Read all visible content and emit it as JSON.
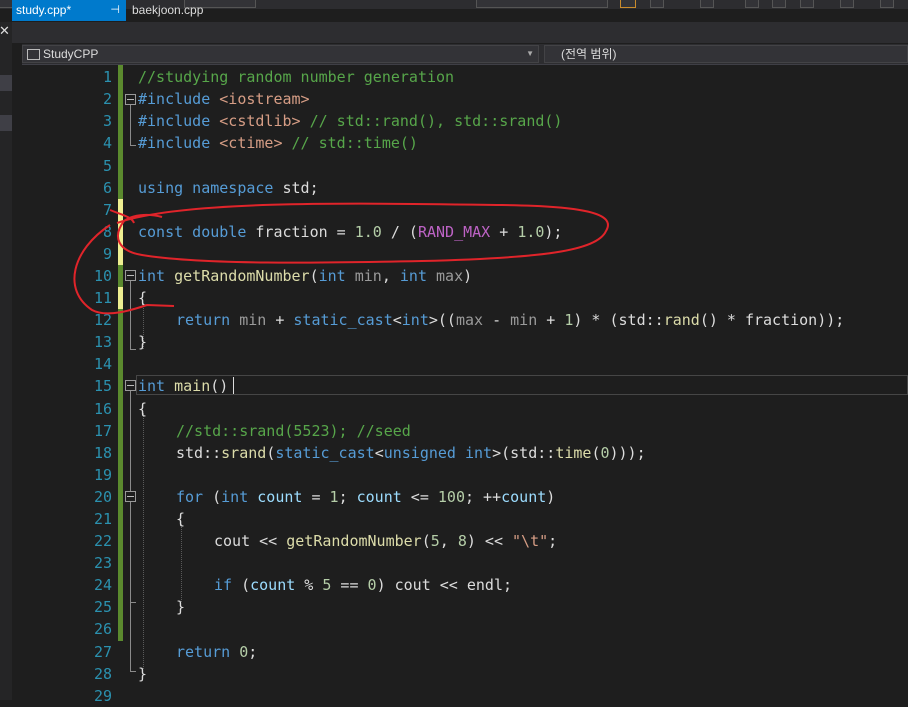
{
  "toolbar": {
    "visible": "partially cut off at top"
  },
  "tabs": [
    {
      "label": "study.cpp*",
      "pin": "⊣",
      "active": true
    },
    {
      "label": "baekjoon.cpp",
      "active": false
    }
  ],
  "left_panel": {
    "close_glyph": "✕",
    "dropdown_glyph": "▾"
  },
  "nav": {
    "project": "StudyCPP",
    "scope": "(전역 범위)"
  },
  "editor": {
    "line_numbers": [
      "1",
      "2",
      "3",
      "4",
      "5",
      "6",
      "7",
      "8",
      "9",
      "10",
      "11",
      "12",
      "13",
      "14",
      "15",
      "16",
      "17",
      "18",
      "19",
      "20",
      "21",
      "22",
      "23",
      "24",
      "25",
      "26",
      "27",
      "28",
      "29"
    ],
    "lines": {
      "l1": "//studying random number generation",
      "l2_kw": "#include ",
      "l2_hdr": "<iostream>",
      "l3_kw": "#include ",
      "l3_hdr": "<cstdlib>",
      "l3_cm": " // std::rand(), std::srand()",
      "l4_kw": "#include ",
      "l4_hdr": "<ctime>",
      "l4_cm": " // std::time()",
      "l6_a": "using namespace",
      "l6_b": " std;",
      "l8_a": "const double",
      "l8_b": " fraction = ",
      "l8_c": "1.0",
      "l8_d": " / (",
      "l8_e": "RAND_MAX",
      "l8_f": " + ",
      "l8_g": "1.0",
      "l8_h": ");",
      "l10_a": "int",
      "l10_b": " getRandomNumber",
      "l10_c": "(",
      "l10_d": "int",
      "l10_e": " min",
      "l10_f": ", ",
      "l10_g": "int",
      "l10_h": " max",
      "l10_i": ")",
      "l11": "{",
      "l12_a": "return",
      "l12_b": " min",
      "l12_c": " + ",
      "l12_d": "static_cast",
      "l12_e": "<",
      "l12_f": "int",
      "l12_g": ">((",
      "l12_h": "max",
      "l12_i": " - ",
      "l12_j": "min",
      "l12_k": " + ",
      "l12_l": "1",
      "l12_m": ") * (std::",
      "l12_n": "rand",
      "l12_o": "() * ",
      "l12_p": "fraction",
      "l12_q": "));",
      "l13": "}",
      "l15_a": "int",
      "l15_b": " main",
      "l15_c": "()",
      "l16": "{",
      "l17": "//std::srand(5523); //seed",
      "l18_a": "std::",
      "l18_b": "srand",
      "l18_c": "(",
      "l18_d": "static_cast",
      "l18_e": "<",
      "l18_f": "unsigned int",
      "l18_g": ">(std::",
      "l18_h": "time",
      "l18_i": "(",
      "l18_j": "0",
      "l18_k": ")));",
      "l20_a": "for",
      "l20_b": " (",
      "l20_c": "int",
      "l20_d": " count",
      "l20_e": " = ",
      "l20_f": "1",
      "l20_g": "; ",
      "l20_h": "count",
      "l20_i": " <= ",
      "l20_j": "100",
      "l20_k": "; ++",
      "l20_l": "count",
      "l20_m": ")",
      "l21": "{",
      "l22_a": "cout",
      "l22_b": " << ",
      "l22_c": "getRandomNumber",
      "l22_d": "(",
      "l22_e": "5",
      "l22_f": ", ",
      "l22_g": "8",
      "l22_h": ") << ",
      "l22_i": "\"\\t\"",
      "l22_j": ";",
      "l24_a": "if",
      "l24_b": " (",
      "l24_c": "count",
      "l24_d": " % ",
      "l24_e": "5",
      "l24_f": " == ",
      "l24_g": "0",
      "l24_h": ") cout << endl;",
      "l25": "}",
      "l27_a": "return",
      "l27_b": " ",
      "l27_c": "0",
      "l27_d": ";",
      "l28": "}"
    }
  },
  "colors": {
    "background": "#1e1e1e",
    "keyword": "#569cd6",
    "comment": "#57a64a",
    "string": "#d69d85",
    "number": "#b5cea8",
    "function": "#dcdcaa",
    "macro": "#bd63c5",
    "line_number": "#2b91af",
    "saved_change": "#5b8a2e",
    "unsaved_change": "#efef91",
    "annotation": "#e0242a",
    "active_tab": "#007acc"
  },
  "annotation": {
    "description": "hand-drawn red circle around line 8"
  }
}
